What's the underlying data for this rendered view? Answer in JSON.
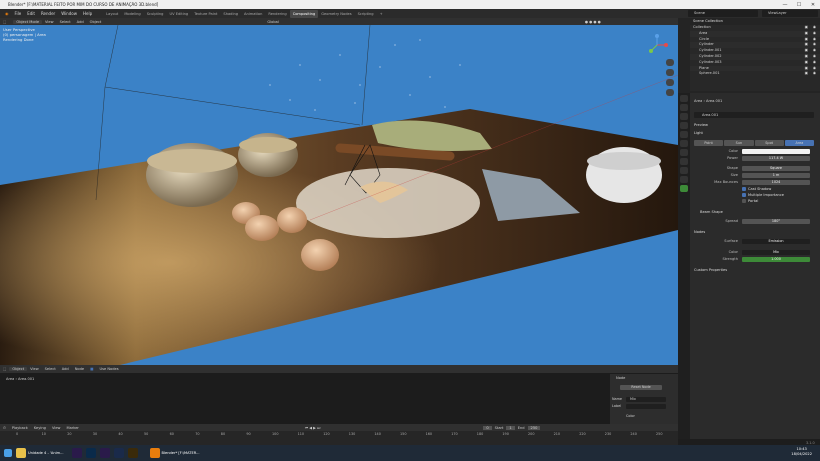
{
  "window": {
    "title": "Blender* [F:\\MATERIAL FEITO POR MIM DO CURSO DE ANIMAÇÃO 3D.blend]",
    "min": "—",
    "max": "☐",
    "close": "✕"
  },
  "menu": [
    "File",
    "Edit",
    "Render",
    "Window",
    "Help"
  ],
  "workspaces": [
    {
      "label": "Layout",
      "active": false
    },
    {
      "label": "Modeling",
      "active": false
    },
    {
      "label": "Sculpting",
      "active": false
    },
    {
      "label": "UV Editing",
      "active": false
    },
    {
      "label": "Texture Paint",
      "active": false
    },
    {
      "label": "Shading",
      "active": false
    },
    {
      "label": "Animation",
      "active": false
    },
    {
      "label": "Rendering",
      "active": false
    },
    {
      "label": "Compositing",
      "active": true
    },
    {
      "label": "Geometry Nodes",
      "active": false
    },
    {
      "label": "Scripting",
      "active": false
    },
    {
      "label": "+",
      "active": false
    }
  ],
  "scene": "Scene",
  "view_layer": "ViewLayer",
  "viewport_header": {
    "mode": "Object Mode",
    "items": [
      "View",
      "Select",
      "Add",
      "Object"
    ],
    "orientation": "Global"
  },
  "viewport_info": {
    "line1": "User Perspective",
    "line2": "(0) personagem | Area",
    "line3": "Rendering Done"
  },
  "outliner": {
    "title": "Scene Collection",
    "rows": [
      {
        "label": "Collection",
        "selected": false
      },
      {
        "label": "Area",
        "selected": false
      },
      {
        "label": "Circle",
        "selected": false
      },
      {
        "label": "Cylinder",
        "selected": false
      },
      {
        "label": "Cylinder.001",
        "selected": false
      },
      {
        "label": "Cylinder.002",
        "selected": false
      },
      {
        "label": "Cylinder.003",
        "selected": false
      },
      {
        "label": "Plane",
        "selected": false
      },
      {
        "label": "Sphere.001",
        "selected": false
      }
    ]
  },
  "properties": {
    "breadcrumb_obj": "Area",
    "breadcrumb_data": "Area.001",
    "datablock": "Area.001",
    "sections": {
      "preview": "Preview",
      "light": "Light",
      "beam_shape": "Beam Shape",
      "nodes": "Nodes",
      "custom": "Custom Properties"
    },
    "light_types": [
      "Point",
      "Sun",
      "Spot",
      "Area"
    ],
    "active_light_type": "Area",
    "color_label": "Color",
    "power_label": "Power",
    "power_value": "117.4 W",
    "shape_label": "Shape",
    "shape_value": "Square",
    "size_label": "Size",
    "size_value": "1 m",
    "max_bounces_label": "Max Bounces",
    "max_bounces_value": "1024",
    "cast_shadow": "Cast Shadow",
    "multiple_importance": "Multiple Importance",
    "portal": "Portal",
    "spread_label": "Spread",
    "spread_value": "180°",
    "surface_label": "Surface",
    "surface_value": "Emission",
    "color2_label": "Color",
    "color2_value": "Mix",
    "strength_label": "Strength",
    "strength_value": "1.000",
    "strength_color": "#3d8a38"
  },
  "node_header": {
    "items": [
      "Object",
      "View",
      "Select",
      "Add",
      "Node"
    ],
    "use_nodes": "Use Nodes",
    "breadcrumb_obj": "Area",
    "breadcrumb_data": "Area.001"
  },
  "node_panel": {
    "title": "Node",
    "reset": "Reset Node",
    "name_label": "Name",
    "name_value": "Mix",
    "label_label": "Label",
    "color_label": "Color"
  },
  "timeline": {
    "items": [
      "Playback",
      "Keying",
      "View",
      "Marker"
    ],
    "current": "0",
    "start_label": "Start",
    "start": "1",
    "end_label": "End",
    "end": "250",
    "ticks": [
      "0",
      "10",
      "20",
      "30",
      "40",
      "50",
      "60",
      "70",
      "80",
      "90",
      "100",
      "110",
      "120",
      "130",
      "140",
      "150",
      "160",
      "170",
      "180",
      "190",
      "200",
      "210",
      "220",
      "230",
      "240",
      "250"
    ]
  },
  "version": "3.1.0",
  "taskbar": {
    "item1": "Unidade 4 - 'Anim...",
    "item2": "Blender* [F:\\MATER...",
    "time": "10:43",
    "date": "18/04/2022"
  },
  "colors": {
    "viewport_bg": "#3b82c7",
    "accent": "#4772b3"
  }
}
